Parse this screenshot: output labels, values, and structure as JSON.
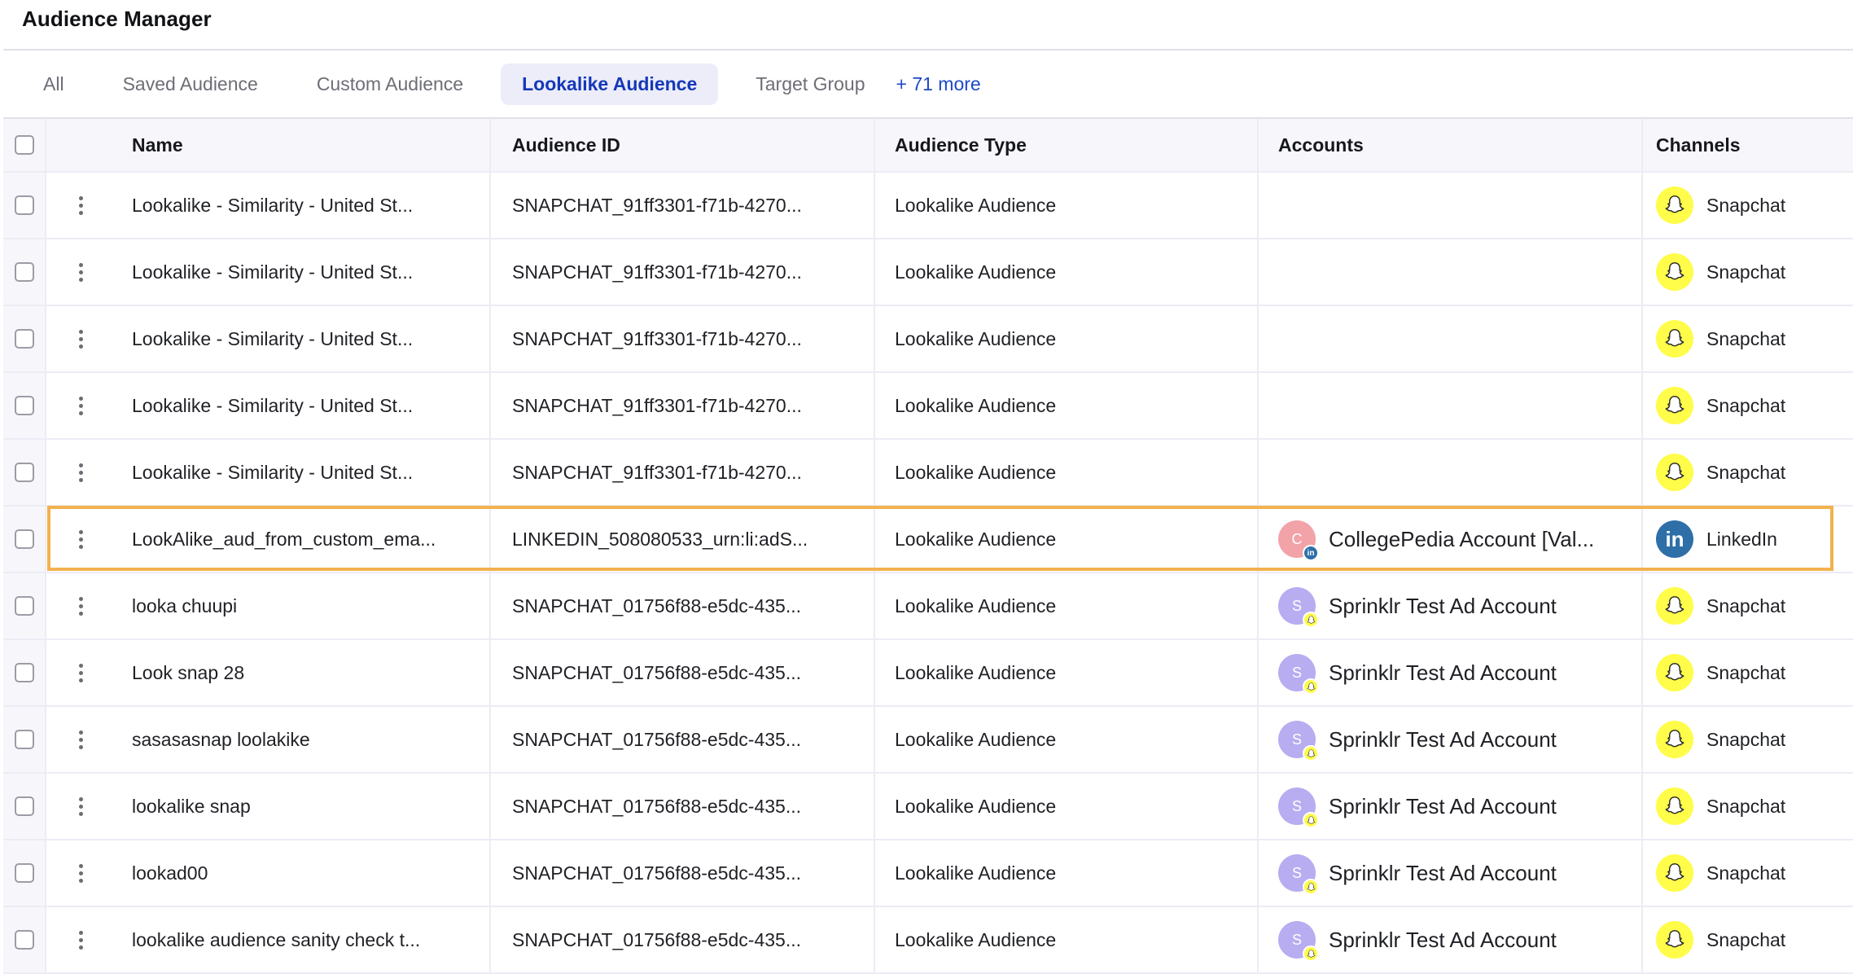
{
  "page": {
    "title": "Audience Manager"
  },
  "tabs": [
    {
      "label": "All",
      "active": false
    },
    {
      "label": "Saved Audience",
      "active": false
    },
    {
      "label": "Custom Audience",
      "active": false
    },
    {
      "label": "Lookalike Audience",
      "active": true
    },
    {
      "label": "Target Group",
      "active": false
    }
  ],
  "more_tabs_label": "+ 71 more",
  "table": {
    "columns": [
      "Name",
      "Audience ID",
      "Audience Type",
      "Accounts",
      "Channels"
    ],
    "rows": [
      {
        "name": "Lookalike - Similarity - United St...",
        "audience_id": "SNAPCHAT_91ff3301-f71b-4270...",
        "type": "Lookalike Audience",
        "account": null,
        "channel": "Snapchat"
      },
      {
        "name": "Lookalike - Similarity - United St...",
        "audience_id": "SNAPCHAT_91ff3301-f71b-4270...",
        "type": "Lookalike Audience",
        "account": null,
        "channel": "Snapchat"
      },
      {
        "name": "Lookalike - Similarity - United St...",
        "audience_id": "SNAPCHAT_91ff3301-f71b-4270...",
        "type": "Lookalike Audience",
        "account": null,
        "channel": "Snapchat"
      },
      {
        "name": "Lookalike - Similarity - United St...",
        "audience_id": "SNAPCHAT_91ff3301-f71b-4270...",
        "type": "Lookalike Audience",
        "account": null,
        "channel": "Snapchat"
      },
      {
        "name": "Lookalike - Similarity - United St...",
        "audience_id": "SNAPCHAT_91ff3301-f71b-4270...",
        "type": "Lookalike Audience",
        "account": null,
        "channel": "Snapchat"
      },
      {
        "name": "LookAlike_aud_from_custom_ema...",
        "audience_id": "LINKEDIN_508080533_urn:li:adS...",
        "type": "Lookalike Audience",
        "account": {
          "initial": "C",
          "name": "CollegePedia Account [Val...",
          "color": "#f2a3a8",
          "network": "linkedin"
        },
        "channel": "LinkedIn",
        "highlighted": true
      },
      {
        "name": "looka chuupi",
        "audience_id": "SNAPCHAT_01756f88-e5dc-435...",
        "type": "Lookalike Audience",
        "account": {
          "initial": "S",
          "name": "Sprinklr Test Ad Account",
          "color": "#b7adf0",
          "network": "snapchat"
        },
        "channel": "Snapchat"
      },
      {
        "name": "Look snap 28",
        "audience_id": "SNAPCHAT_01756f88-e5dc-435...",
        "type": "Lookalike Audience",
        "account": {
          "initial": "S",
          "name": "Sprinklr Test Ad Account",
          "color": "#b7adf0",
          "network": "snapchat"
        },
        "channel": "Snapchat"
      },
      {
        "name": "sasasasnap loolakike",
        "audience_id": "SNAPCHAT_01756f88-e5dc-435...",
        "type": "Lookalike Audience",
        "account": {
          "initial": "S",
          "name": "Sprinklr Test Ad Account",
          "color": "#b7adf0",
          "network": "snapchat"
        },
        "channel": "Snapchat"
      },
      {
        "name": "lookalike snap",
        "audience_id": "SNAPCHAT_01756f88-e5dc-435...",
        "type": "Lookalike Audience",
        "account": {
          "initial": "S",
          "name": "Sprinklr Test Ad Account",
          "color": "#b7adf0",
          "network": "snapchat"
        },
        "channel": "Snapchat"
      },
      {
        "name": "lookad00",
        "audience_id": "SNAPCHAT_01756f88-e5dc-435...",
        "type": "Lookalike Audience",
        "account": {
          "initial": "S",
          "name": "Sprinklr Test Ad Account",
          "color": "#b7adf0",
          "network": "snapchat"
        },
        "channel": "Snapchat"
      },
      {
        "name": "lookalike audience sanity check t...",
        "audience_id": "SNAPCHAT_01756f88-e5dc-435...",
        "type": "Lookalike Audience",
        "account": {
          "initial": "S",
          "name": "Sprinklr Test Ad Account",
          "color": "#b7adf0",
          "network": "snapchat"
        },
        "channel": "Snapchat"
      }
    ]
  },
  "colors": {
    "active_tab_text": "#1538b8",
    "active_tab_bg": "#ecedf9",
    "highlight_border": "#f2b24e",
    "snapchat_yellow": "#fffc4a",
    "linkedin_blue": "#2f6fa8"
  }
}
